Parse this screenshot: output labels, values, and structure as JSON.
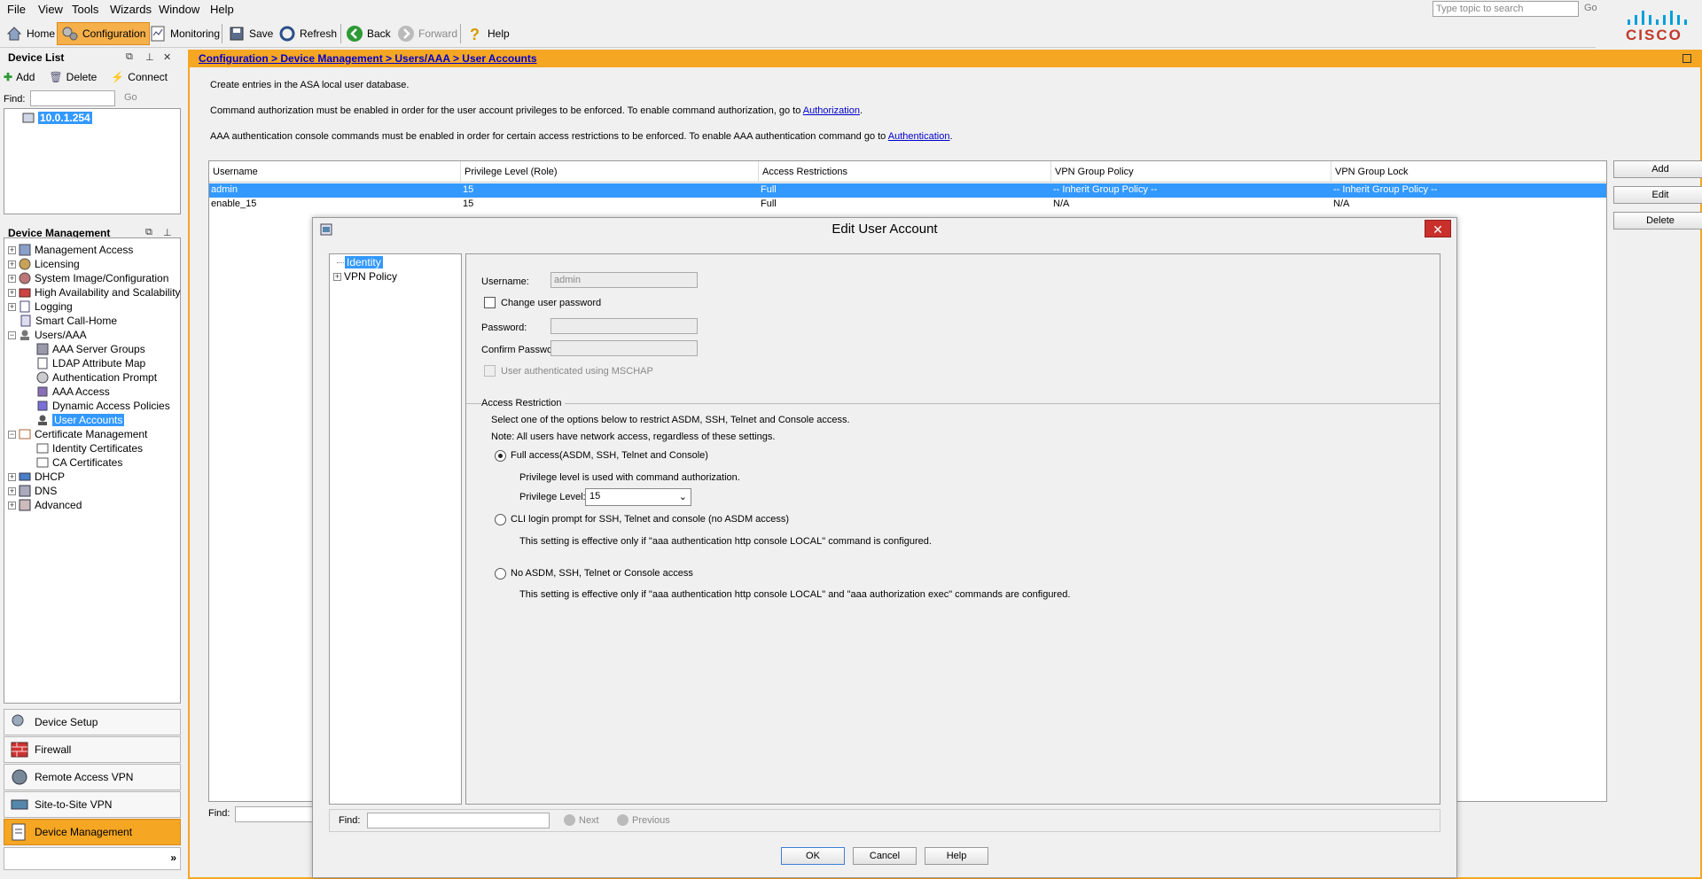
{
  "menubar": {
    "items": [
      "File",
      "View",
      "Tools",
      "Wizards",
      "Window",
      "Help"
    ],
    "search_placeholder": "Type topic to search",
    "search_go": "Go",
    "logo_text": "CISCO"
  },
  "toolbar": {
    "home": "Home",
    "configuration": "Configuration",
    "monitoring": "Monitoring",
    "save": "Save",
    "refresh": "Refresh",
    "back": "Back",
    "forward": "Forward",
    "help": "Help"
  },
  "device_list": {
    "title": "Device List",
    "add": "Add",
    "delete": "Delete",
    "connect": "Connect",
    "find_label": "Find:",
    "go": "Go",
    "device": "10.0.1.254"
  },
  "device_management": {
    "title": "Device Management",
    "items": [
      {
        "label": "Management Access"
      },
      {
        "label": "Licensing"
      },
      {
        "label": "System Image/Configuration"
      },
      {
        "label": "High Availability and Scalability"
      },
      {
        "label": "Logging"
      },
      {
        "label": "Smart Call-Home"
      },
      {
        "label": "Users/AAA"
      },
      {
        "label": "AAA Server Groups"
      },
      {
        "label": "LDAP Attribute Map"
      },
      {
        "label": "Authentication Prompt"
      },
      {
        "label": "AAA Access"
      },
      {
        "label": "Dynamic Access Policies"
      },
      {
        "label": "User Accounts"
      },
      {
        "label": "Certificate Management"
      },
      {
        "label": "Identity Certificates"
      },
      {
        "label": "CA Certificates"
      },
      {
        "label": "DHCP"
      },
      {
        "label": "DNS"
      },
      {
        "label": "Advanced"
      }
    ]
  },
  "nav_buttons": {
    "device_setup": "Device Setup",
    "firewall": "Firewall",
    "remote_access_vpn": "Remote Access VPN",
    "site_to_site_vpn": "Site-to-Site VPN",
    "device_management": "Device Management",
    "more": "»"
  },
  "content": {
    "breadcrumb": "Configuration > Device Management > Users/AAA > User Accounts",
    "intro": "Create entries in the ASA local user database.",
    "cmd_auth_text": "Command authorization must be enabled in order for the user account privileges to be enforced. To enable command authorization, go to",
    "cmd_auth_link": "Authorization",
    "aaa_text": "AAA authentication console commands must be enabled in order for certain access restrictions to be enforced. To enable AAA authentication command go to",
    "aaa_link": "Authentication",
    "table": {
      "headers": [
        "Username",
        "Privilege Level (Role)",
        "Access Restrictions",
        "VPN Group Policy",
        "VPN Group Lock"
      ],
      "rows": [
        [
          "admin",
          "15",
          "Full",
          "-- Inherit Group Policy --",
          "-- Inherit Group Policy --"
        ],
        [
          "enable_15",
          "15",
          "Full",
          "N/A",
          "N/A"
        ]
      ]
    },
    "buttons": {
      "add": "Add",
      "edit": "Edit",
      "delete": "Delete"
    },
    "find_label": "Find:"
  },
  "dialog": {
    "title": "Edit User Account",
    "close": "✕",
    "nav": {
      "identity": "Identity",
      "vpn_policy": "VPN Policy"
    },
    "username_label": "Username:",
    "username_value": "admin",
    "change_password_label": "Change user password",
    "password_label": "Password:",
    "confirm_password_label": "Confirm Password:",
    "mschap_label": "User authenticated using MSCHAP",
    "access_restriction_title": "Access Restriction",
    "access_restriction_desc": "Select one of the options below to restrict ASDM, SSH, Telnet and Console access.",
    "access_restriction_note": "Note: All users have network access, regardless of these settings.",
    "full_access_label": "Full access(ASDM, SSH, Telnet and Console)",
    "full_access_desc": "Privilege level is used with command authorization.",
    "privilege_level_label": "Privilege Level:",
    "privilege_level_value": "15",
    "cli_label": "CLI login prompt for SSH, Telnet and console (no ASDM access)",
    "cli_desc": "This setting is effective only if \"aaa authentication http console LOCAL\" command is configured.",
    "no_access_label": "No ASDM, SSH, Telnet or Console access",
    "no_access_desc": "This setting is effective only if \"aaa authentication http console LOCAL\" and \"aaa authorization exec\" commands are configured.",
    "find_label": "Find:",
    "next": "Next",
    "previous": "Previous",
    "ok": "OK",
    "cancel": "Cancel",
    "help": "Help"
  }
}
